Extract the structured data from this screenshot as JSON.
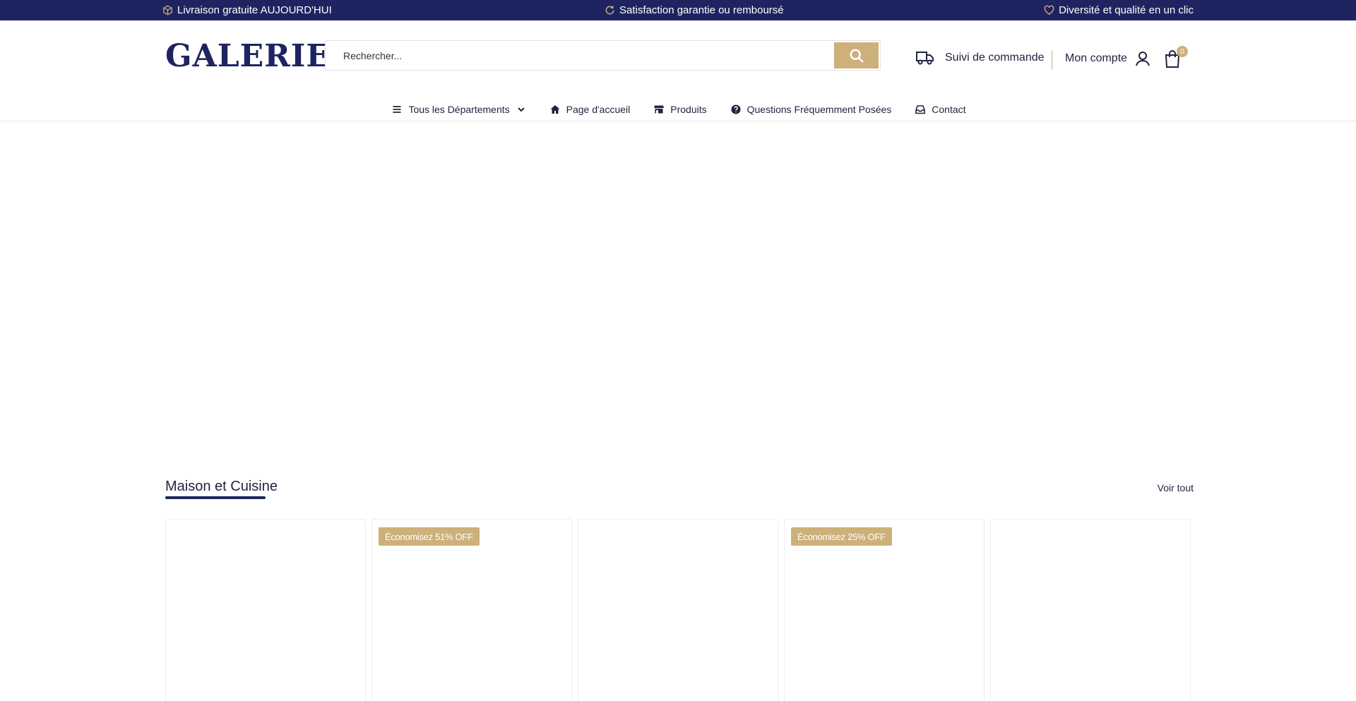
{
  "topbar": {
    "delivery": "Livraison gratuite AUJOURD'HUI",
    "satisfaction": "Satisfaction garantie ou remboursé",
    "diversity": "Diversité et qualité en un clic",
    "colors": {
      "background": "#1e2460",
      "text": "#ffffff"
    },
    "icons": [
      "box-icon",
      "refresh-icon",
      "heart-icon"
    ]
  },
  "header": {
    "logo_text": "GALERIE",
    "search": {
      "placeholder": "Rechercher...",
      "value": ""
    },
    "order_tracking": "Suivi de commande",
    "account": "Mon compte",
    "cart_count": "0",
    "accent_color": "#cdb07a"
  },
  "nav": {
    "departments": "Tous les Départements",
    "home": "Page d'accueil",
    "products": "Produits",
    "faq": "Questions Fréquemment Posées",
    "contact": "Contact"
  },
  "section": {
    "title": "Maison et Cuisine",
    "see_all": "Voir tout",
    "products": [
      {
        "badge": ""
      },
      {
        "badge": "Économisez 51% OFF"
      },
      {
        "badge": ""
      },
      {
        "badge": "Économisez 25% OFF"
      },
      {
        "badge": ""
      }
    ]
  }
}
